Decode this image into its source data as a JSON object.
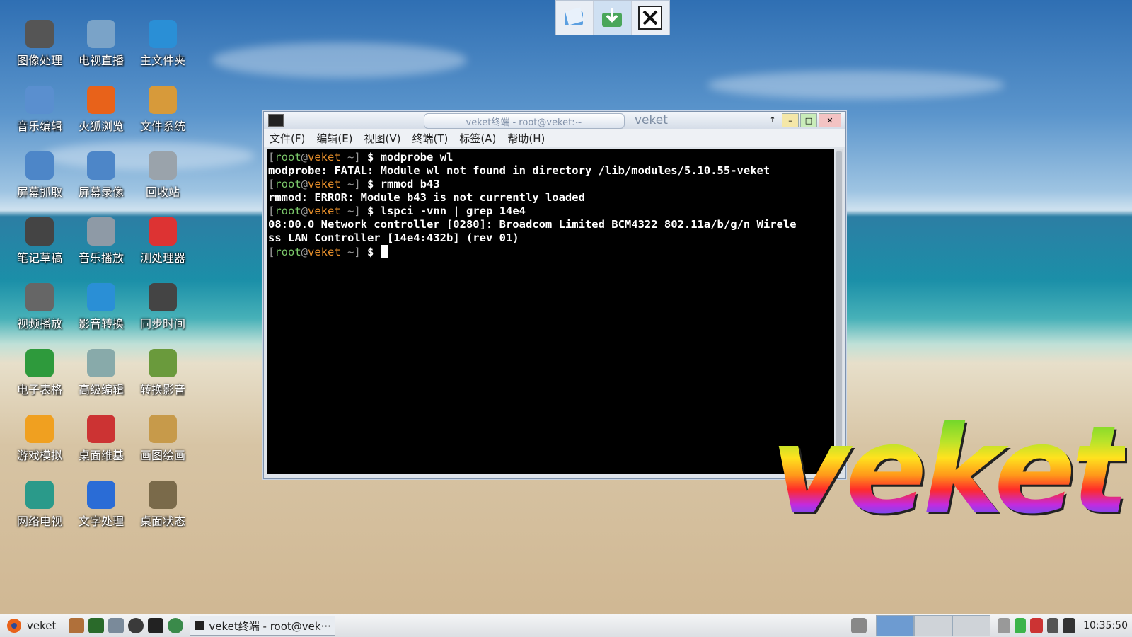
{
  "desktop_icons": [
    {
      "label": "图像处理",
      "icon": "gimp-icon",
      "color": "#555"
    },
    {
      "label": "电视直播",
      "icon": "tv-icon",
      "color": "#7aa3c8"
    },
    {
      "label": "主文件夹",
      "icon": "home-folder-icon",
      "color": "#2a8fd6"
    },
    {
      "label": "音乐编辑",
      "icon": "audio-edit-icon",
      "color": "#5a8fcf"
    },
    {
      "label": "火狐浏览",
      "icon": "firefox-icon",
      "color": "#e8621a"
    },
    {
      "label": "文件系统",
      "icon": "filesystem-icon",
      "color": "#d79a3a"
    },
    {
      "label": "屏幕抓取",
      "icon": "screenshot-icon",
      "color": "#4d86c8"
    },
    {
      "label": "屏幕录像",
      "icon": "screen-record-icon",
      "color": "#4d86c8"
    },
    {
      "label": "回收站",
      "icon": "trash-icon",
      "color": "#9aa3ab"
    },
    {
      "label": "笔记草稿",
      "icon": "notes-icon",
      "color": "#444"
    },
    {
      "label": "音乐播放",
      "icon": "speaker-icon",
      "color": "#8e9aa6"
    },
    {
      "label": "测处理器",
      "icon": "cpu-test-icon",
      "color": "#d33"
    },
    {
      "label": "视频播放",
      "icon": "video-player-icon",
      "color": "#666"
    },
    {
      "label": "影音转换",
      "icon": "media-convert-icon",
      "color": "#2a8fd6"
    },
    {
      "label": "同步时间",
      "icon": "calendar-icon",
      "color": "#444"
    },
    {
      "label": "电子表格",
      "icon": "spreadsheet-icon",
      "color": "#2e9a3c"
    },
    {
      "label": "高级编辑",
      "icon": "text-editor-icon",
      "color": "#8aa"
    },
    {
      "label": "转换影音",
      "icon": "convert-video-icon",
      "color": "#6a9a3c"
    },
    {
      "label": "游戏模拟",
      "icon": "game-emulator-icon",
      "color": "#f0a020"
    },
    {
      "label": "桌面维基",
      "icon": "wiki-icon",
      "color": "#c33"
    },
    {
      "label": "画图绘画",
      "icon": "paint-icon",
      "color": "#c79a4a"
    },
    {
      "label": "网络电视",
      "icon": "play-icon",
      "color": "#2a9a8a"
    },
    {
      "label": "文字处理",
      "icon": "word-processor-icon",
      "color": "#2a6cd6"
    },
    {
      "label": "桌面状态",
      "icon": "desktop-status-icon",
      "color": "#7a6a4a"
    }
  ],
  "launcher": {
    "items": [
      "folder-icon",
      "download-icon",
      "close-icon"
    ]
  },
  "window": {
    "tab_title": "veket终端 - root@veket:~",
    "name": "veket",
    "menu": [
      "文件(F)",
      "编辑(E)",
      "视图(V)",
      "终端(T)",
      "标签(A)",
      "帮助(H)"
    ],
    "lines": [
      {
        "prompt": true,
        "cmd": "modprobe wl"
      },
      {
        "prompt": false,
        "text": "modprobe: FATAL: Module wl not found in directory /lib/modules/5.10.55-veket"
      },
      {
        "prompt": true,
        "cmd": "rmmod b43"
      },
      {
        "prompt": false,
        "text": "rmmod: ERROR: Module b43 is not currently loaded"
      },
      {
        "prompt": true,
        "cmd": "lspci -vnn | grep 14e4"
      },
      {
        "prompt": false,
        "text": "08:00.0 Network controller [0280]: Broadcom Limited BCM4322 802.11a/b/g/n Wirele"
      },
      {
        "prompt": false,
        "text": "ss LAN Controller [14e4:432b] (rev 01)"
      },
      {
        "prompt": true,
        "cmd": "",
        "cursor": true
      }
    ],
    "prompt_user": "root",
    "prompt_host": "veket",
    "prompt_dir": "~"
  },
  "logo_text": "veket",
  "taskbar": {
    "start_label": "veket",
    "task_label": "veket终端 - root@vek···",
    "clock": "10:35:50"
  }
}
